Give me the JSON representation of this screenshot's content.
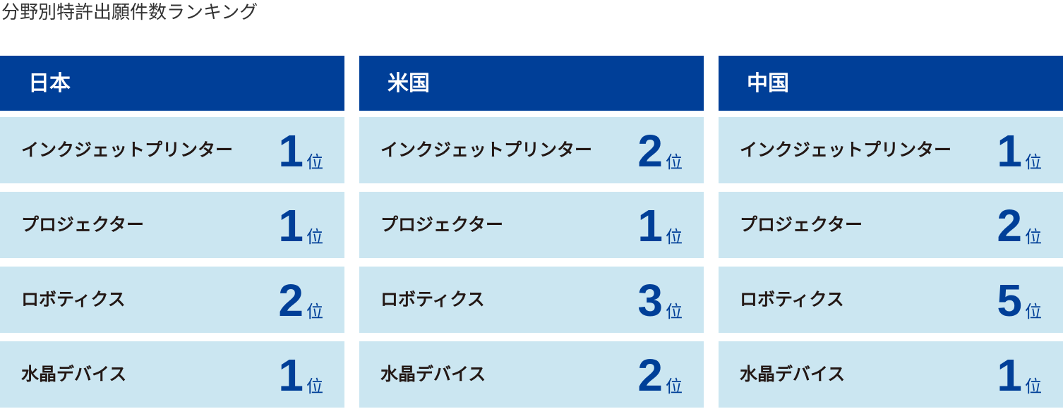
{
  "title": "分野別特許出願件数ランキング",
  "rank_unit": "位",
  "columns": [
    {
      "header": "日本",
      "rows": [
        {
          "label": "インクジェットプリンター",
          "rank": "1"
        },
        {
          "label": "プロジェクター",
          "rank": "1"
        },
        {
          "label": "ロボティクス",
          "rank": "2"
        },
        {
          "label": "水晶デバイス",
          "rank": "1"
        }
      ]
    },
    {
      "header": "米国",
      "rows": [
        {
          "label": "インクジェットプリンター",
          "rank": "2"
        },
        {
          "label": "プロジェクター",
          "rank": "1"
        },
        {
          "label": "ロボティクス",
          "rank": "3"
        },
        {
          "label": "水晶デバイス",
          "rank": "2"
        }
      ]
    },
    {
      "header": "中国",
      "rows": [
        {
          "label": "インクジェットプリンター",
          "rank": "1"
        },
        {
          "label": "プロジェクター",
          "rank": "2"
        },
        {
          "label": "ロボティクス",
          "rank": "5"
        },
        {
          "label": "水晶デバイス",
          "rank": "1"
        }
      ]
    }
  ],
  "colors": {
    "header_bg": "#003f98",
    "row_bg": "#cbe6f1",
    "rank_color": "#003f98"
  }
}
